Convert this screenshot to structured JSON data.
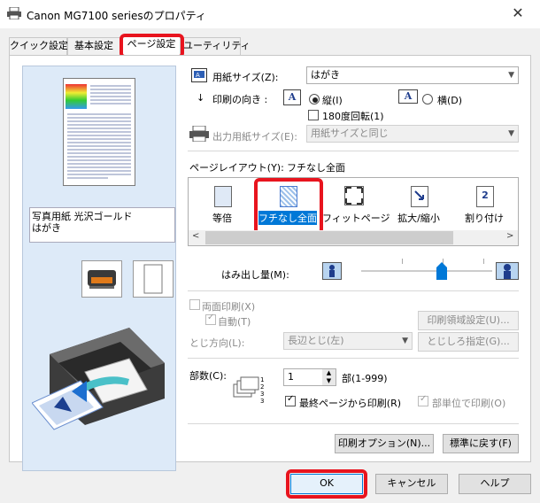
{
  "window": {
    "title": "Canon MG7100 seriesのプロパティ",
    "close": "✕"
  },
  "tabs": [
    {
      "label": "クイック設定"
    },
    {
      "label": "基本設定"
    },
    {
      "label": "ページ設定"
    },
    {
      "label": "ユーティリティ"
    }
  ],
  "preview": {
    "media": "写真用紙 光沢ゴールド\nはがき"
  },
  "page_size": {
    "label": "用紙サイズ(Z):",
    "value": "はがき"
  },
  "orientation": {
    "label": "印刷の向き :",
    "portrait": "縦(I)",
    "landscape": "横(D)",
    "rotate180": "180度回転(1)"
  },
  "output_size": {
    "label": "出力用紙サイズ(E):",
    "value": "用紙サイズと同じ"
  },
  "page_layout": {
    "label": "ページレイアウト(Y):",
    "value": "フチなし全面",
    "items": [
      {
        "label": "等倍"
      },
      {
        "label": "フチなし全面"
      },
      {
        "label": "フィットページ"
      },
      {
        "label": "拡大/縮小"
      },
      {
        "label": "割り付け"
      }
    ]
  },
  "extension": {
    "label": "はみ出し量(M):"
  },
  "duplex": {
    "label": "両面印刷(X)",
    "auto": "自動(T)",
    "area_button": "印刷領域設定(U)...",
    "binding_label": "とじ方向(L):",
    "binding_value": "長辺とじ(左)",
    "margin_button": "とじしろ指定(G)..."
  },
  "copies": {
    "label": "部数(C):",
    "value": "1",
    "range": "部(1-999)",
    "last_first": "最終ページから印刷(R)",
    "collate": "部単位で印刷(O)"
  },
  "buttons": {
    "print_options": "印刷オプション(N)...",
    "defaults": "標準に戻す(F)",
    "ok": "OK",
    "cancel": "キャンセル",
    "help": "ヘルプ"
  },
  "colors": {
    "highlight": "#e8141e",
    "preview_bg": "#ddeaf8",
    "selection": "#0078d7"
  }
}
